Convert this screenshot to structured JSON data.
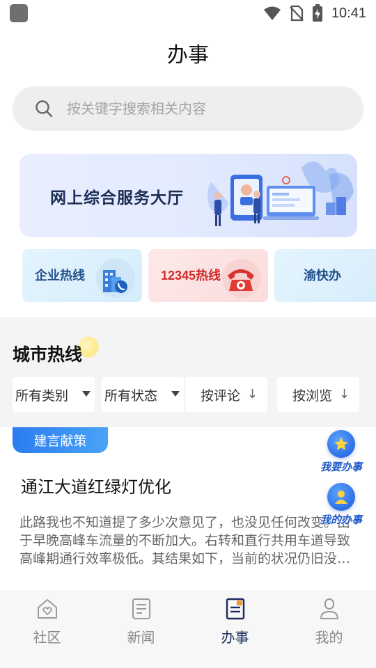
{
  "status_bar": {
    "time": "10:41"
  },
  "page": {
    "title": "办事"
  },
  "search": {
    "placeholder": "按关键字搜索相关内容",
    "icon": "search-icon"
  },
  "banner": {
    "title": "网上综合服务大厅"
  },
  "service_cards": [
    {
      "label": "企业热线",
      "icon": "building-phone-icon"
    },
    {
      "label": "12345热线",
      "icon": "telephone-icon"
    },
    {
      "label": "渝快办",
      "icon": ""
    }
  ],
  "section": {
    "title": "城市热线"
  },
  "filters": [
    {
      "label": "所有类别"
    },
    {
      "label": "所有状态"
    },
    {
      "label": "按评论",
      "arrow": "↓"
    },
    {
      "label": "按浏览",
      "arrow": "↓"
    }
  ],
  "post": {
    "tag": "建言献策",
    "title": "通江大道红绿灯优化",
    "body": "此路我也不知道提了多少次意见了，也没见任何改变。由于早晚高峰车流量的不断加大。右转和直行共用车道导致高峰期通行效率极低。其结果如下，当前的状况仍旧没有任何改善。"
  },
  "floating": [
    {
      "label": "我要办事",
      "icon": "star-icon"
    },
    {
      "label": "我的办事",
      "icon": "person-icon"
    }
  ],
  "tabbar": [
    {
      "label": "社区",
      "icon": "home-heart-icon",
      "active": false
    },
    {
      "label": "新闻",
      "icon": "news-icon",
      "active": false
    },
    {
      "label": "办事",
      "icon": "task-icon",
      "active": true
    },
    {
      "label": "我的",
      "icon": "user-icon",
      "active": false
    }
  ],
  "colors": {
    "accent": "#2b7cf0",
    "active_tab": "#1a2b5e",
    "hotline_red": "#d12a2a"
  }
}
